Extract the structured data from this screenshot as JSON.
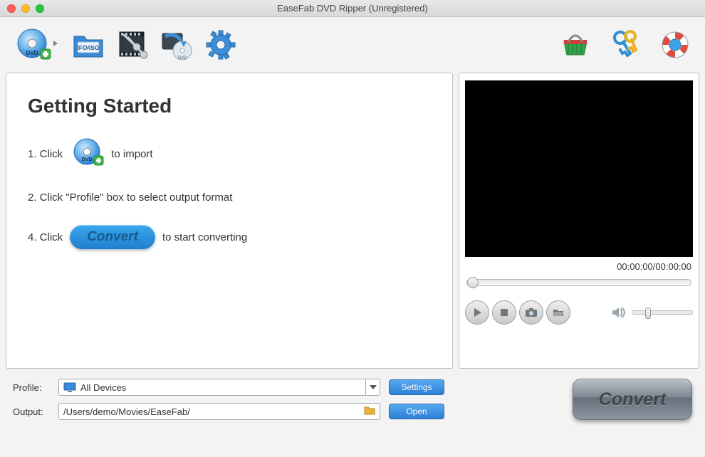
{
  "window": {
    "title": "EaseFab DVD Ripper (Unregistered)"
  },
  "toolbar": {
    "load_dvd": "load-dvd",
    "load_ifo": "IFO/ISO",
    "edit": "edit-video",
    "merge": "merge",
    "settings": "settings-gear",
    "buy": "shopping-basket",
    "register": "register-key",
    "help": "help-lifebuoy"
  },
  "getting_started": {
    "heading": "Getting Started",
    "step1_pre": "1. Click",
    "step1_post": "to import",
    "step2": "2. Click \"Profile\" box to select output format",
    "step4_pre": "4. Click",
    "step4_btn": "Convert",
    "step4_post": "to start converting"
  },
  "preview": {
    "time": "00:00:00/00:00:00"
  },
  "bottom": {
    "profile_label": "Profile:",
    "profile_value": "All Devices",
    "settings_btn": "Settings",
    "output_label": "Output:",
    "output_value": "/Users/demo/Movies/EaseFab/",
    "open_btn": "Open",
    "convert_btn": "Convert"
  }
}
